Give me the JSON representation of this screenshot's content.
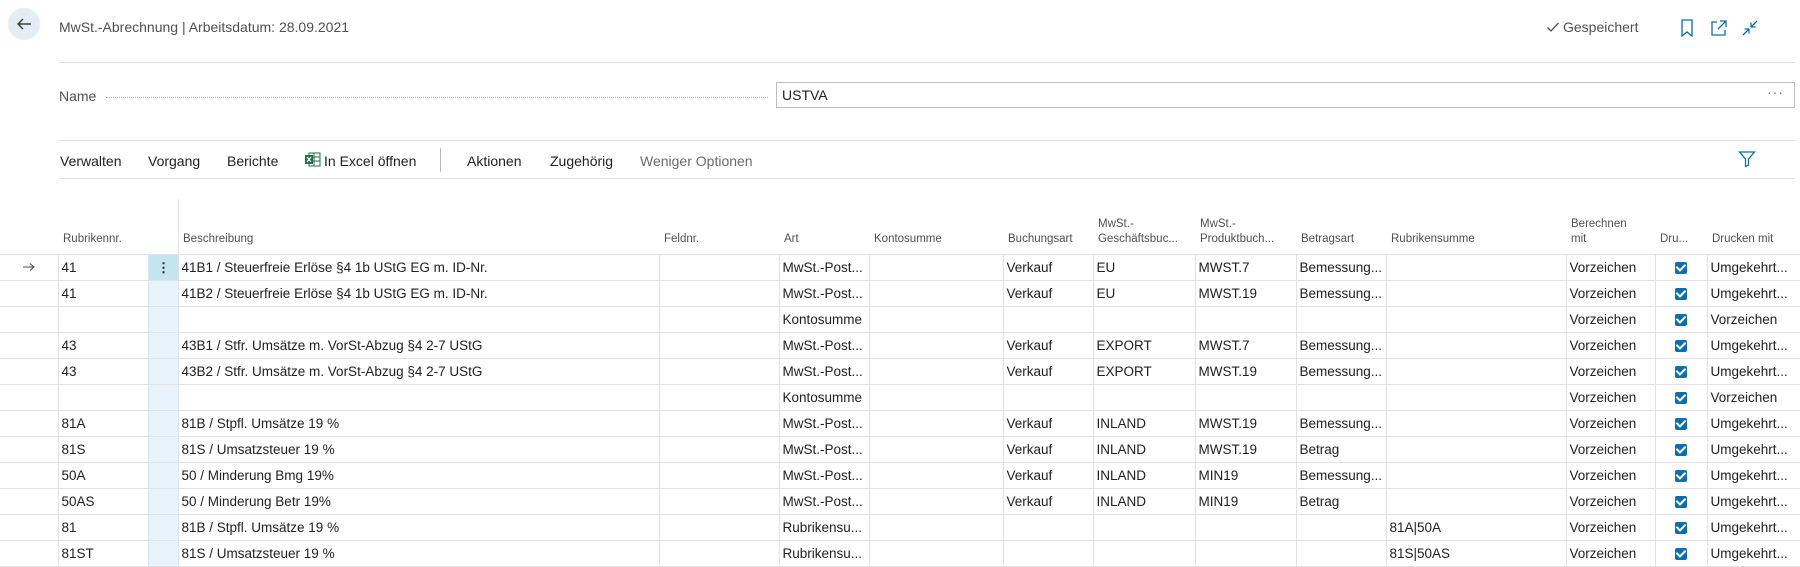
{
  "header": {
    "title": "MwSt.-Abrechnung | Arbeitsdatum: 28.09.2021",
    "saved_label": "Gespeichert",
    "icons": [
      "back-arrow-icon",
      "checkmark-icon",
      "bookmark-icon",
      "open-new-window-icon",
      "collapse-icon"
    ]
  },
  "name_field": {
    "label": "Name",
    "value": "USTVA",
    "more": "···"
  },
  "action_bar": {
    "items": [
      "Verwalten",
      "Vorgang",
      "Berichte",
      "In Excel öffnen",
      "Aktionen",
      "Zugehörig",
      "Weniger Optionen"
    ],
    "icons": [
      "excel-icon",
      "filter-icon"
    ]
  },
  "table": {
    "columns": [
      {
        "l1": "",
        "l2": "Rubrikennr."
      },
      {
        "l1": "",
        "l2": "Beschreibung"
      },
      {
        "l1": "",
        "l2": "Feldnr."
      },
      {
        "l1": "",
        "l2": "Art"
      },
      {
        "l1": "",
        "l2": "Kontosumme"
      },
      {
        "l1": "",
        "l2": "Buchungsart"
      },
      {
        "l1": "MwSt.-",
        "l2": "Geschäftsbuc..."
      },
      {
        "l1": "MwSt.-",
        "l2": "Produktbuch..."
      },
      {
        "l1": "",
        "l2": "Betragsart"
      },
      {
        "l1": "",
        "l2": "Rubrikensumme"
      },
      {
        "l1": "Berechnen",
        "l2": "mit"
      },
      {
        "l1": "",
        "l2": "Dru..."
      },
      {
        "l1": "",
        "l2": "Drucken mit"
      }
    ],
    "rows": [
      {
        "nr": "41",
        "desc": "41B1 / Steuerfreie Erlöse §4 1b UStG EG m. ID-Nr.",
        "feld": "",
        "art": "MwSt.-Post...",
        "konto": "",
        "buchung": "Verkauf",
        "gesch": "EU",
        "prod": "MWST.7",
        "betrag": "Bemessung...",
        "rubsum": "",
        "berechnen": "Vorzeichen",
        "drucken": true,
        "druckenmit": "Umgekehrt..."
      },
      {
        "nr": "41",
        "desc": "41B2 / Steuerfreie Erlöse §4 1b UStG EG m. ID-Nr.",
        "feld": "",
        "art": "MwSt.-Post...",
        "konto": "",
        "buchung": "Verkauf",
        "gesch": "EU",
        "prod": "MWST.19",
        "betrag": "Bemessung...",
        "rubsum": "",
        "berechnen": "Vorzeichen",
        "drucken": true,
        "druckenmit": "Umgekehrt..."
      },
      {
        "nr": "",
        "desc": "",
        "feld": "",
        "art": "Kontosumme",
        "konto": "",
        "buchung": "",
        "gesch": "",
        "prod": "",
        "betrag": "",
        "rubsum": "",
        "berechnen": "Vorzeichen",
        "drucken": true,
        "druckenmit": "Vorzeichen"
      },
      {
        "nr": "43",
        "desc": "43B1 / Stfr. Umsätze m. VorSt-Abzug §4 2-7 UStG",
        "feld": "",
        "art": "MwSt.-Post...",
        "konto": "",
        "buchung": "Verkauf",
        "gesch": "EXPORT",
        "prod": "MWST.7",
        "betrag": "Bemessung...",
        "rubsum": "",
        "berechnen": "Vorzeichen",
        "drucken": true,
        "druckenmit": "Umgekehrt..."
      },
      {
        "nr": "43",
        "desc": "43B2 / Stfr. Umsätze m. VorSt-Abzug §4 2-7 UStG",
        "feld": "",
        "art": "MwSt.-Post...",
        "konto": "",
        "buchung": "Verkauf",
        "gesch": "EXPORT",
        "prod": "MWST.19",
        "betrag": "Bemessung...",
        "rubsum": "",
        "berechnen": "Vorzeichen",
        "drucken": true,
        "druckenmit": "Umgekehrt..."
      },
      {
        "nr": "",
        "desc": "",
        "feld": "",
        "art": "Kontosumme",
        "konto": "",
        "buchung": "",
        "gesch": "",
        "prod": "",
        "betrag": "",
        "rubsum": "",
        "berechnen": "Vorzeichen",
        "drucken": true,
        "druckenmit": "Vorzeichen"
      },
      {
        "nr": "81A",
        "desc": "81B / Stpfl. Umsätze 19 %",
        "feld": "",
        "art": "MwSt.-Post...",
        "konto": "",
        "buchung": "Verkauf",
        "gesch": "INLAND",
        "prod": "MWST.19",
        "betrag": "Bemessung...",
        "rubsum": "",
        "berechnen": "Vorzeichen",
        "drucken": true,
        "druckenmit": "Umgekehrt..."
      },
      {
        "nr": "81S",
        "desc": "81S / Umsatzsteuer 19 %",
        "feld": "",
        "art": "MwSt.-Post...",
        "konto": "",
        "buchung": "Verkauf",
        "gesch": "INLAND",
        "prod": "MWST.19",
        "betrag": "Betrag",
        "rubsum": "",
        "berechnen": "Vorzeichen",
        "drucken": true,
        "druckenmit": "Umgekehrt..."
      },
      {
        "nr": "50A",
        "desc": "50 / Minderung Bmg 19%",
        "feld": "",
        "art": "MwSt.-Post...",
        "konto": "",
        "buchung": "Verkauf",
        "gesch": "INLAND",
        "prod": "MIN19",
        "betrag": "Bemessung...",
        "rubsum": "",
        "berechnen": "Vorzeichen",
        "drucken": true,
        "druckenmit": "Umgekehrt..."
      },
      {
        "nr": "50AS",
        "desc": "50 / Minderung Betr 19%",
        "feld": "",
        "art": "MwSt.-Post...",
        "konto": "",
        "buchung": "Verkauf",
        "gesch": "INLAND",
        "prod": "MIN19",
        "betrag": "Betrag",
        "rubsum": "",
        "berechnen": "Vorzeichen",
        "drucken": true,
        "druckenmit": "Umgekehrt..."
      },
      {
        "nr": "81",
        "desc": "81B / Stpfl. Umsätze 19 %",
        "feld": "",
        "art": "Rubrikensu...",
        "konto": "",
        "buchung": "",
        "gesch": "",
        "prod": "",
        "betrag": "",
        "rubsum": "81A|50A",
        "berechnen": "Vorzeichen",
        "drucken": true,
        "druckenmit": "Umgekehrt..."
      },
      {
        "nr": "81ST",
        "desc": "81S / Umsatzsteuer 19 %",
        "feld": "",
        "art": "Rubrikensu...",
        "konto": "",
        "buchung": "",
        "gesch": "",
        "prod": "",
        "betrag": "",
        "rubsum": "81S|50AS",
        "berechnen": "Vorzeichen",
        "drucken": true,
        "druckenmit": "Umgekehrt..."
      }
    ]
  },
  "colors": {
    "accent": "#0a6fad",
    "back_button_bg": "#e3edf5",
    "active_menu_cell": "#c4e4ef"
  }
}
